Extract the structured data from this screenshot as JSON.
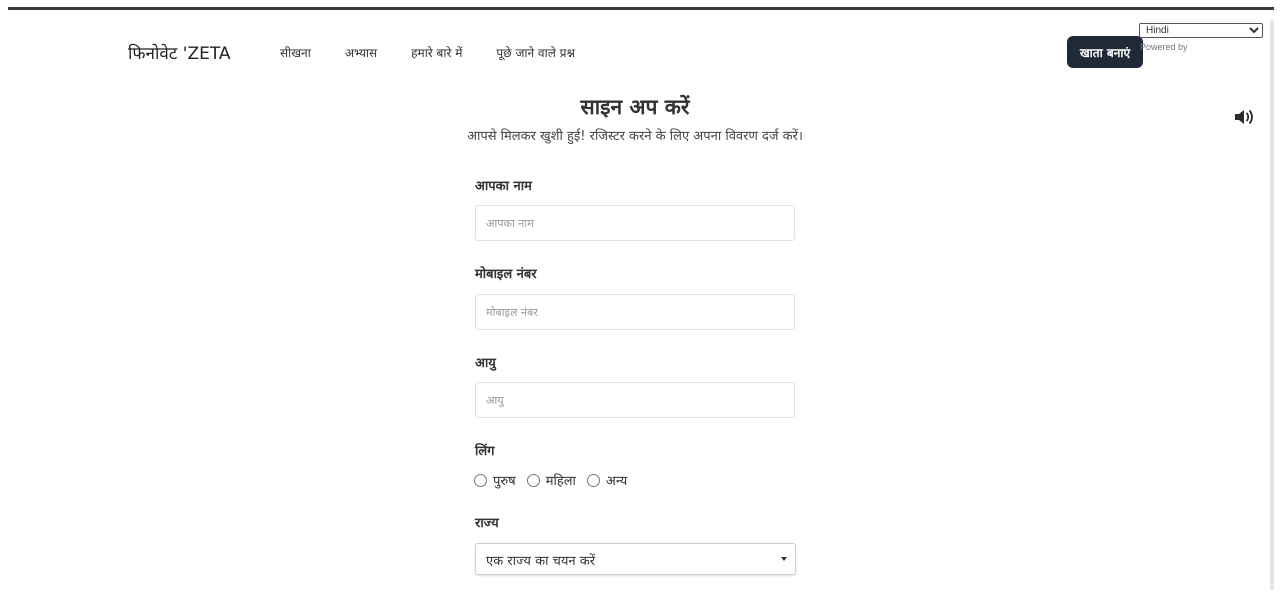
{
  "header": {
    "brand": "फिनोवेट 'ZETA",
    "nav": [
      "सीखना",
      "अभ्यास",
      "हमारे बारे में",
      "पूछे जाने वाले प्रश्न"
    ],
    "create_account_label": "खाता बनाएं",
    "language": {
      "selected": "Hindi",
      "powered_by": "Powered by"
    }
  },
  "icons": {
    "speaker": "speaker-volume-icon",
    "select_caret": "caret-down-icon"
  },
  "form": {
    "title": "साइन अप करें",
    "subtitle": "आपसे मिलकर खुशी हुई! रजिस्टर करने के लिए अपना विवरण दर्ज करें।",
    "name": {
      "label": "आपका नाम",
      "placeholder": "आपका नाम",
      "value": ""
    },
    "mobile": {
      "label": "मोबाइल नंबर",
      "placeholder": "मोबाइल नंबर",
      "value": ""
    },
    "age": {
      "label": "आयु",
      "placeholder": "आयु",
      "value": ""
    },
    "gender": {
      "label": "लिंग",
      "options": [
        "पुरुष",
        "महिला",
        "अन्य"
      ]
    },
    "state": {
      "label": "राज्य",
      "selected": "एक राज्य का चयन करें"
    }
  },
  "colors": {
    "button_bg": "#1f2937",
    "button_text": "#ffffff",
    "text": "#333333",
    "placeholder": "#9a9a9a",
    "border": "#e3e3e3"
  }
}
